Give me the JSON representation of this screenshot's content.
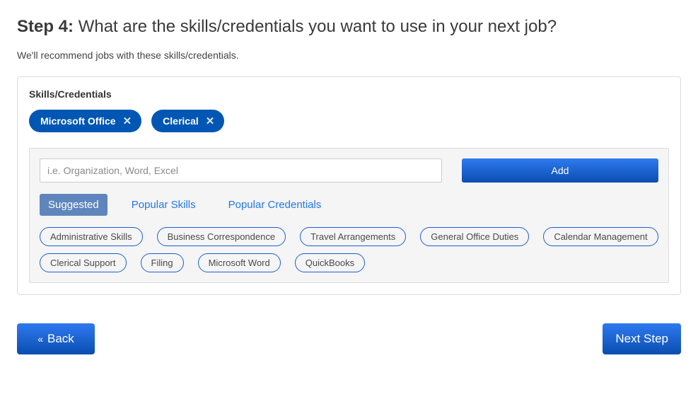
{
  "step": {
    "label": "Step 4:",
    "question": "What are the skills/credentials you want to use in your next job?",
    "subtitle": "We'll recommend jobs with these skills/credentials."
  },
  "card": {
    "title": "Skills/Credentials",
    "selected": [
      {
        "label": "Microsoft Office"
      },
      {
        "label": "Clerical"
      }
    ]
  },
  "panel": {
    "input_placeholder": "i.e. Organization, Word, Excel",
    "add_label": "Add",
    "tabs": {
      "suggested": "Suggested",
      "popular_skills": "Popular Skills",
      "popular_credentials": "Popular Credentials",
      "active": "suggested"
    },
    "suggestions": [
      "Administrative Skills",
      "Business Correspondence",
      "Travel Arrangements",
      "General Office Duties",
      "Calendar Management",
      "Clerical Support",
      "Filing",
      "Microsoft Word",
      "QuickBooks"
    ]
  },
  "nav": {
    "back_label": "Back",
    "next_label": "Next Step"
  }
}
